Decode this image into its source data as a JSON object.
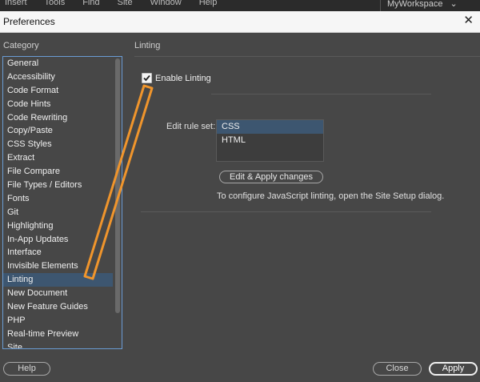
{
  "app_menu": {
    "items": [
      "Insert",
      "Tools",
      "Find",
      "Site",
      "Window",
      "Help"
    ],
    "workspace": "MyWorkspace"
  },
  "dialog": {
    "title": "Preferences",
    "close_glyph": "✕",
    "category_heading": "Category",
    "section_heading": "Linting"
  },
  "categories": [
    "General",
    "Accessibility",
    "Code Format",
    "Code Hints",
    "Code Rewriting",
    "Copy/Paste",
    "CSS Styles",
    "Extract",
    "File Compare",
    "File Types / Editors",
    "Fonts",
    "Git",
    "Highlighting",
    "In-App Updates",
    "Interface",
    "Invisible Elements",
    "Linting",
    "New Document",
    "New Feature Guides",
    "PHP",
    "Real-time Preview",
    "Site"
  ],
  "selected_category": "Linting",
  "linting": {
    "enable_label": "Enable Linting",
    "enabled": true,
    "edit_rule_label": "Edit rule set:",
    "rule_sets": [
      "CSS",
      "HTML"
    ],
    "selected_rule_set": "CSS",
    "apply_button": "Edit  & Apply changes",
    "info": "To configure JavaScript linting, open the Site Setup dialog."
  },
  "footer": {
    "help": "Help",
    "close": "Close",
    "apply": "Apply"
  },
  "annotation_color": "#f0952c"
}
